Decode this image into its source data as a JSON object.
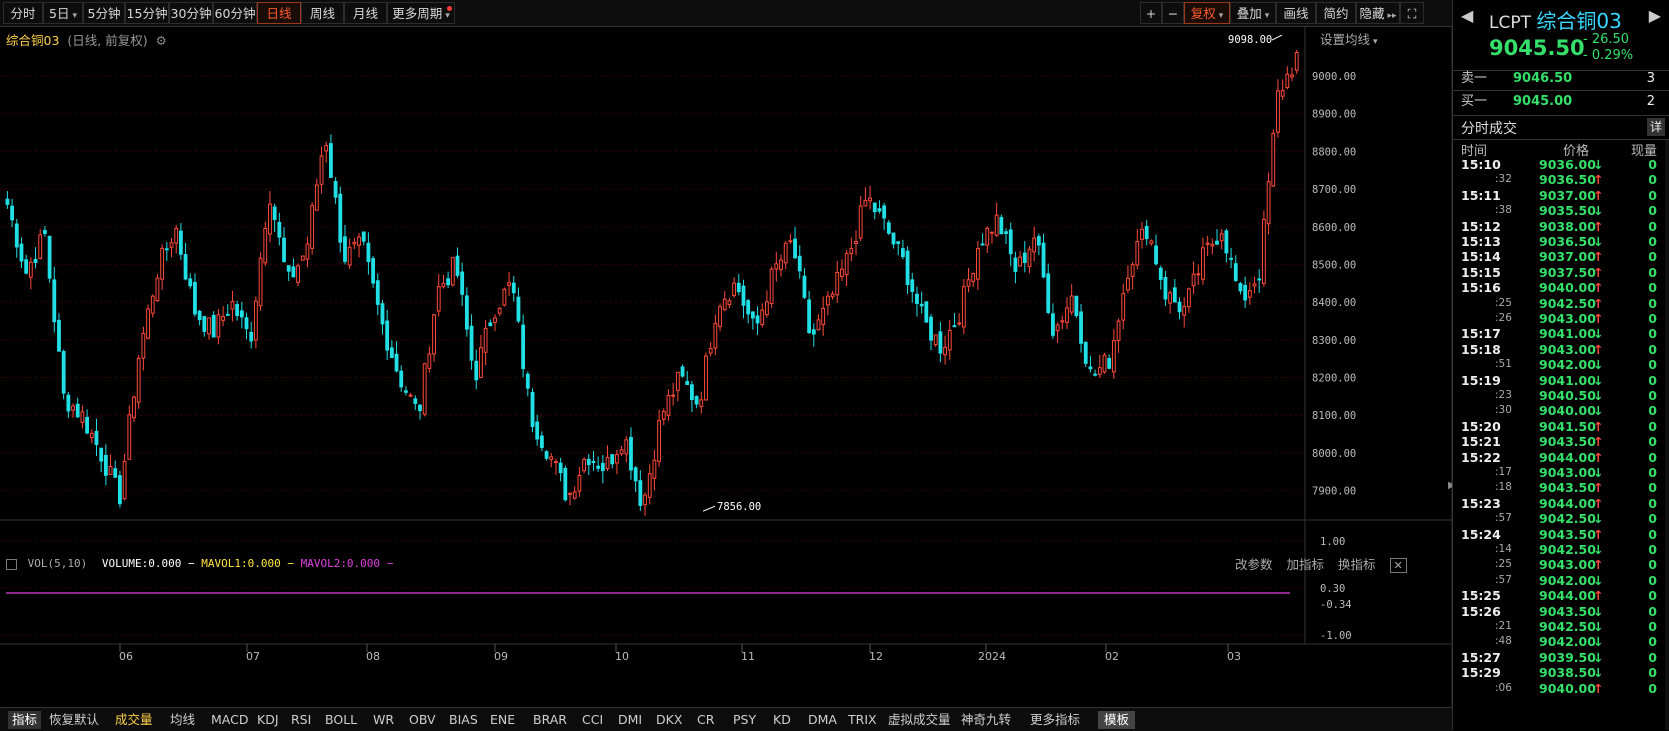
{
  "colors": {
    "up": "#ff4a3a",
    "down": "#20e0e6",
    "grid": "#3a0000",
    "text": "#cccccc",
    "accent": "#ffd24a",
    "green": "#35e06a",
    "ma2": "#e040e0"
  },
  "toolbar": {
    "left": [
      {
        "label": "分时"
      },
      {
        "label": "5日",
        "caret": "▾"
      },
      {
        "label": "5分钟"
      },
      {
        "label": "15分钟"
      },
      {
        "label": "30分钟"
      },
      {
        "label": "60分钟"
      },
      {
        "label": "日线",
        "active": true
      },
      {
        "label": "周线"
      },
      {
        "label": "月线"
      },
      {
        "label": "更多周期",
        "caret": "▾"
      }
    ],
    "right": [
      {
        "label": "+"
      },
      {
        "label": "−"
      },
      {
        "label": "复权",
        "caret": "▾",
        "active": true
      },
      {
        "label": "叠加",
        "caret": "▾"
      },
      {
        "label": "画线"
      },
      {
        "label": "简约"
      },
      {
        "label": "隐藏",
        "caret": "▸▸"
      },
      {
        "label": "⛶"
      }
    ]
  },
  "chart": {
    "name": "综合铜03",
    "sub": "(日线, 前复权)",
    "set_ma": "设置均线",
    "high_label": "9098.00",
    "low_label": "7856.00",
    "y_ticks": [
      "9000.00",
      "8900.00",
      "8800.00",
      "8700.00",
      "8600.00",
      "8500.00",
      "8400.00",
      "8300.00",
      "8200.00",
      "8100.00",
      "8000.00",
      "7900.00"
    ],
    "x_ticks": [
      "06",
      "07",
      "08",
      "09",
      "10",
      "11",
      "12",
      "2024",
      "02",
      "03"
    ]
  },
  "chart_data": {
    "type": "candlestick",
    "title": "综合铜03 (日线, 前复权)",
    "y_range": [
      7830,
      9130
    ],
    "months": [
      "06",
      "07",
      "08",
      "09",
      "10",
      "11",
      "12",
      "2024",
      "02",
      "03"
    ],
    "keypoints": [
      8660,
      8480,
      8580,
      8150,
      8100,
      8000,
      7880,
      8250,
      8480,
      8600,
      8380,
      8320,
      8400,
      8300,
      8700,
      8450,
      8540,
      8850,
      8520,
      8550,
      8350,
      8200,
      8100,
      8430,
      8500,
      8200,
      8380,
      8450,
      8100,
      8000,
      7880,
      8000,
      7960,
      8050,
      7860,
      8100,
      8200,
      8130,
      8400,
      8450,
      8320,
      8480,
      8560,
      8300,
      8400,
      8520,
      8680,
      8600,
      8500,
      8350,
      8280,
      8380,
      8560,
      8620,
      8480,
      8580,
      8320,
      8420,
      8200,
      8250,
      8500,
      8600,
      8420,
      8380,
      8520,
      8600,
      8400,
      8480,
      8950,
      9050
    ],
    "high": 9098.0,
    "low": 7856.0
  },
  "volume": {
    "header": "VOL(5,10)",
    "volume_text": "VOLUME:0.000",
    "mavol1_text": "MAVOL1:0.000",
    "mavol2_text": "MAVOL2:0.000",
    "tools": [
      "改参数",
      "加指标",
      "换指标"
    ],
    "close": "✕",
    "y_ticks": [
      "1.00",
      "0.30",
      "-0.34",
      "-1.00"
    ]
  },
  "bottom_tabs": [
    "指标",
    "恢复默认",
    "成交量",
    "均线",
    "MACD",
    "KDJ",
    "RSI",
    "BOLL",
    "WR",
    "OBV",
    "BIAS",
    "ENE",
    "BRAR",
    "CCI",
    "DMI",
    "DKX",
    "CR",
    "PSY",
    "KD",
    "DMA",
    "TRIX",
    "虚拟成交量",
    "神奇九转",
    "更多指标",
    "模板"
  ],
  "right_panel": {
    "ticker": "LCPT",
    "name": "综合铜03",
    "price": "9045.50",
    "change": "- 26.50",
    "change_pct": "- 0.29%",
    "ask_label": "卖一",
    "ask_price": "9046.50",
    "ask_vol": "3",
    "bid_label": "买一",
    "bid_price": "9045.00",
    "bid_vol": "2",
    "trades_title": "分时成交",
    "detail": "详",
    "col_time": "时间",
    "col_price": "价格",
    "col_vol": "现量",
    "trades": [
      {
        "t": "15:10",
        "p": "9036.00",
        "d": "down",
        "v": "0"
      },
      {
        "t": ":32",
        "p": "9036.50",
        "d": "up",
        "v": "0"
      },
      {
        "t": "15:11",
        "p": "9037.00",
        "d": "up",
        "v": "0"
      },
      {
        "t": ":38",
        "p": "9035.50",
        "d": "down",
        "v": "0"
      },
      {
        "t": "15:12",
        "p": "9038.00",
        "d": "up",
        "v": "0"
      },
      {
        "t": "15:13",
        "p": "9036.50",
        "d": "down",
        "v": "0"
      },
      {
        "t": "15:14",
        "p": "9037.00",
        "d": "up",
        "v": "0"
      },
      {
        "t": "15:15",
        "p": "9037.50",
        "d": "up",
        "v": "0"
      },
      {
        "t": "15:16",
        "p": "9040.00",
        "d": "up",
        "v": "0"
      },
      {
        "t": ":25",
        "p": "9042.50",
        "d": "up",
        "v": "0"
      },
      {
        "t": ":26",
        "p": "9043.00",
        "d": "up",
        "v": "0"
      },
      {
        "t": "15:17",
        "p": "9041.00",
        "d": "down",
        "v": "0"
      },
      {
        "t": "15:18",
        "p": "9043.00",
        "d": "up",
        "v": "0"
      },
      {
        "t": ":51",
        "p": "9042.00",
        "d": "down",
        "v": "0"
      },
      {
        "t": "15:19",
        "p": "9041.00",
        "d": "down",
        "v": "0"
      },
      {
        "t": ":23",
        "p": "9040.50",
        "d": "down",
        "v": "0"
      },
      {
        "t": ":30",
        "p": "9040.00",
        "d": "down",
        "v": "0"
      },
      {
        "t": "15:20",
        "p": "9041.50",
        "d": "up",
        "v": "0"
      },
      {
        "t": "15:21",
        "p": "9043.50",
        "d": "up",
        "v": "0"
      },
      {
        "t": "15:22",
        "p": "9044.00",
        "d": "up",
        "v": "0"
      },
      {
        "t": ":17",
        "p": "9043.00",
        "d": "down",
        "v": "0"
      },
      {
        "t": ":18",
        "p": "9043.50",
        "d": "up",
        "v": "0"
      },
      {
        "t": "15:23",
        "p": "9044.00",
        "d": "up",
        "v": "0"
      },
      {
        "t": ":57",
        "p": "9042.50",
        "d": "down",
        "v": "0"
      },
      {
        "t": "15:24",
        "p": "9043.50",
        "d": "up",
        "v": "0"
      },
      {
        "t": ":14",
        "p": "9042.50",
        "d": "down",
        "v": "0"
      },
      {
        "t": ":25",
        "p": "9043.00",
        "d": "up",
        "v": "0"
      },
      {
        "t": ":57",
        "p": "9042.00",
        "d": "down",
        "v": "0"
      },
      {
        "t": "15:25",
        "p": "9044.00",
        "d": "up",
        "v": "0"
      },
      {
        "t": "15:26",
        "p": "9043.50",
        "d": "down",
        "v": "0"
      },
      {
        "t": ":21",
        "p": "9042.50",
        "d": "down",
        "v": "0"
      },
      {
        "t": ":48",
        "p": "9042.00",
        "d": "down",
        "v": "0"
      },
      {
        "t": "15:27",
        "p": "9039.50",
        "d": "down",
        "v": "0"
      },
      {
        "t": "15:29",
        "p": "9038.50",
        "d": "down",
        "v": "0"
      },
      {
        "t": ":06",
        "p": "9040.00",
        "d": "up",
        "v": "0"
      }
    ]
  }
}
